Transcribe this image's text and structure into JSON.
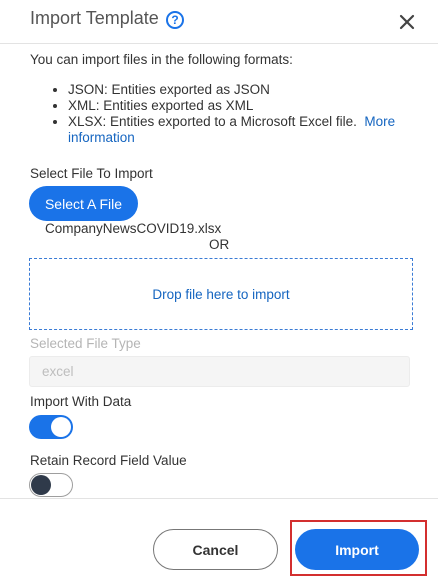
{
  "dialog": {
    "title": "Import Template",
    "help_icon": "question-circle-icon",
    "close_icon": "close-icon"
  },
  "intro": "You can import files in the following formats:",
  "formats": [
    {
      "text": "JSON: Entities exported as JSON"
    },
    {
      "text": "XML: Entities exported as XML"
    },
    {
      "text": "XLSX: Entities exported to a Microsoft Excel file.",
      "link": "More information"
    }
  ],
  "file_section": {
    "label": "Select File To Import",
    "button": "Select A File",
    "selected_file": "CompanyNewsCOVID19.xlsx",
    "or": "OR",
    "dropzone": "Drop file here to import"
  },
  "file_type": {
    "label": "Selected File Type",
    "value": "excel"
  },
  "import_with_data": {
    "label": "Import With Data",
    "state": "on"
  },
  "retain_record": {
    "label": "Retain Record Field Value",
    "state": "off"
  },
  "footer": {
    "cancel": "Cancel",
    "import": "Import"
  },
  "colors": {
    "accent": "#1a73e8",
    "highlight": "#d32f2f"
  }
}
